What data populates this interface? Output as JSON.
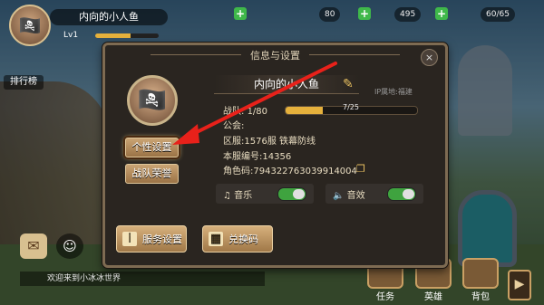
{
  "hud": {
    "player_name": "内向的小人鱼",
    "level": "Lv1",
    "resources": [
      {
        "name": "gem",
        "value": "80"
      },
      {
        "name": "gold",
        "value": "495"
      },
      {
        "name": "stamina",
        "value": "60/65"
      }
    ],
    "side_label": "排行榜",
    "chat_text": "欢迎来到小冰冰世界",
    "bottom_buttons": [
      "任务",
      "英雄",
      "背包"
    ],
    "xp_fraction": 0.55,
    "icons": [
      "chat-icon",
      "friends-icon",
      "plus-icon",
      "arrow-right-icon"
    ]
  },
  "dialog": {
    "title": "信息与设置",
    "close_icon": "×",
    "nickname": "内向的小人鱼",
    "ip_location": "IP属地:福建",
    "team_label": "战队:",
    "team_level": "1/80",
    "team_exp": "7/25",
    "team_exp_fraction": 0.28,
    "guild": "公会:",
    "server": "区服:1576服 铁幕防线",
    "server_no": "本服编号:14356",
    "role_code": "角色码:794322763039914004",
    "side_buttons": {
      "personal": "个性设置",
      "honor": "战队荣誉"
    },
    "music_label": "音乐",
    "sfx_label": "音效",
    "music_on": true,
    "sfx_on": true,
    "service_btn": "服务设置",
    "redeem_btn": "兑换码",
    "accent_color": "#e6b13c",
    "arrow_color": "#e8211a"
  }
}
